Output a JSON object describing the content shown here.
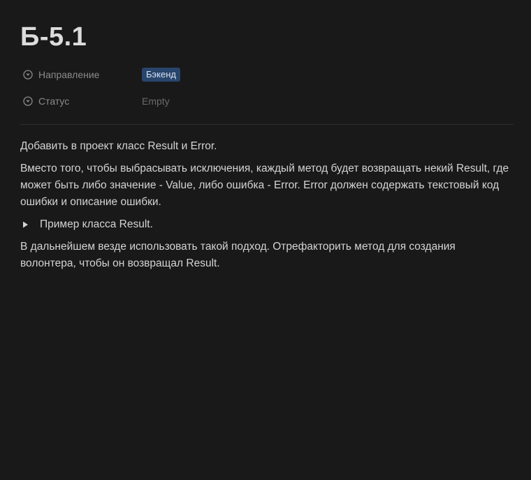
{
  "title": "Б-5.1",
  "properties": [
    {
      "label": "Направление",
      "value": "Бэкенд",
      "icon": "chevron-circle-down-icon"
    },
    {
      "label": "Статус",
      "value": "Empty",
      "icon": "chevron-circle-down-icon"
    }
  ],
  "content": {
    "p1": "Добавить в проект класс Result и Error.",
    "p2": "Вместо того, чтобы выбрасывать исключения, каждый метод будет возвращать некий Result, где может быть либо значение - Value, либо ошибка - Error. Error должен содержать текстовый код ошибки и описание ошибки.",
    "toggle": "Пример класса Result.",
    "p3": "В дальнейшем везде использовать такой подход. Отрефакторить метод для создания волонтера, чтобы он возвращал Result."
  },
  "colors": {
    "background": "#191919",
    "tag_background": "#28456c"
  }
}
